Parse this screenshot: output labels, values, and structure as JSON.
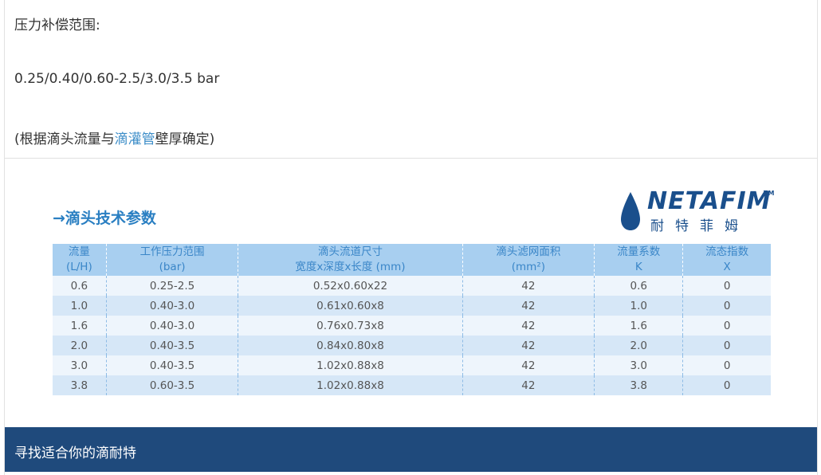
{
  "intro": {
    "line1": "压力补偿范围:",
    "line2": "0.25/0.40/0.60-2.5/3.0/3.5 bar",
    "line3_before": "(根据滴头流量与",
    "line3_link": "滴灌管",
    "line3_after": "壁厚确定)"
  },
  "spec_image": {
    "title": "→滴头技术参数",
    "logo_en": "NETAFIM",
    "logo_tm": "TM",
    "logo_cn": "耐特菲姆",
    "headers": [
      {
        "line1": "流量",
        "line2": "(L/H)"
      },
      {
        "line1": "工作压力范围",
        "line2": "(bar)"
      },
      {
        "line1": "滴头流道尺寸",
        "line2": "宽度x深度x长度 (mm)"
      },
      {
        "line1": "滴头滤网面积",
        "line2": "(mm²)"
      },
      {
        "line1": "流量系数",
        "line2": "K"
      },
      {
        "line1": "流态指数",
        "line2": "X"
      }
    ],
    "rows": [
      [
        "0.6",
        "0.25-2.5",
        "0.52x0.60x22",
        "42",
        "0.6",
        "0"
      ],
      [
        "1.0",
        "0.40-3.0",
        "0.61x0.60x8",
        "42",
        "1.0",
        "0"
      ],
      [
        "1.6",
        "0.40-3.0",
        "0.76x0.73x8",
        "42",
        "1.6",
        "0"
      ],
      [
        "2.0",
        "0.40-3.5",
        "0.84x0.80x8",
        "42",
        "2.0",
        "0"
      ],
      [
        "3.0",
        "0.40-3.5",
        "1.02x0.88x8",
        "42",
        "3.0",
        "0"
      ],
      [
        "3.8",
        "0.60-3.5",
        "1.02x0.88x8",
        "42",
        "3.8",
        "0"
      ]
    ]
  },
  "footer": {
    "label": "寻找适合你的滴耐特"
  },
  "colors": {
    "link": "#3c8dc8",
    "header_bg": "#a8cff0",
    "header_text": "#3a86c8",
    "footer_bg": "#1f4a7c",
    "logo": "#1a4f8c"
  }
}
